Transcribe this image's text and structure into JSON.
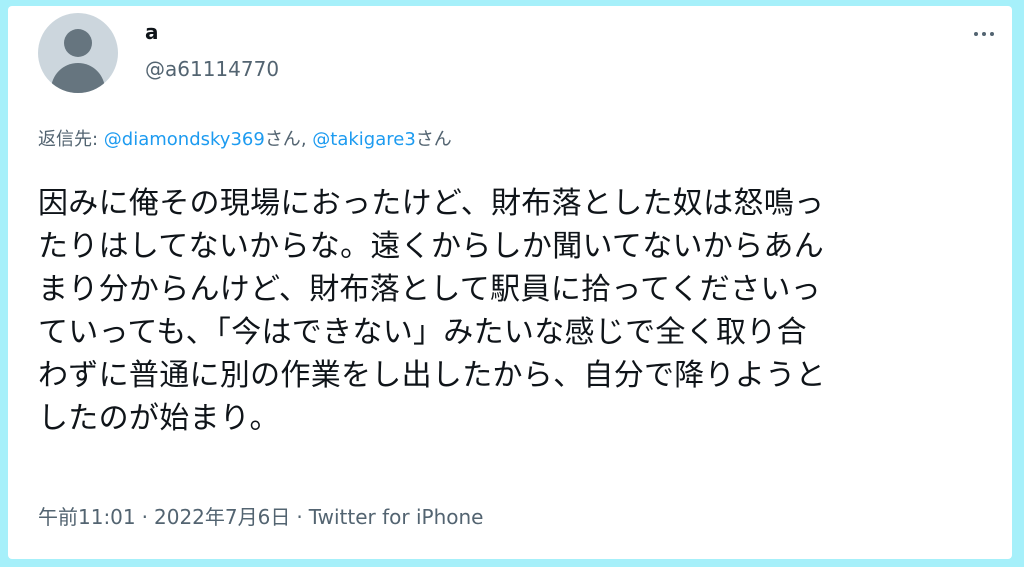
{
  "user": {
    "display_name": "a",
    "handle": "@a61114770",
    "avatar_icon": "default-profile-icon"
  },
  "more_icon": "more-horizontal-icon",
  "reply": {
    "prefix": "返信先: ",
    "mentions": [
      {
        "handle": "@diamondsky369",
        "suffix": "さん"
      },
      {
        "handle": "@takigare3",
        "suffix": "さん"
      }
    ],
    "separator": ", "
  },
  "tweet": {
    "lines": [
      "因みに俺その現場におったけど、財布落とした奴は怒鳴っ",
      "たりはしてないからな。遠くからしか聞いてないからあん",
      "まり分からんけど、財布落として駅員に拾ってくださいっ",
      "ていっても、「今はできない」みたいな感じで全く取り合",
      "わずに普通に別の作業をし出したから、自分で降りようと",
      "したのが始まり。"
    ]
  },
  "meta": {
    "time": "午前11:01",
    "separator": "·",
    "date": "2022年7月6日",
    "source": "Twitter for iPhone"
  },
  "colors": {
    "background": "#a6f0fa",
    "card": "#ffffff",
    "text": "#0f1419",
    "secondary": "#536471",
    "link": "#1d9bf0"
  }
}
